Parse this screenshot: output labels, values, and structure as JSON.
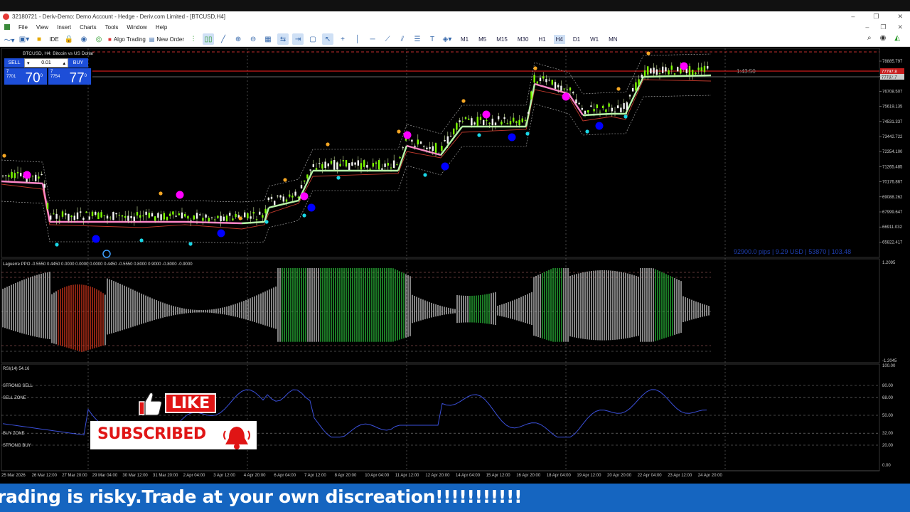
{
  "window": {
    "title": "32180721 - Deriv-Demo: Demo Account - Hedge - Deriv.com Limited - [BTCUSD,H4]",
    "controls": [
      "–",
      "❐",
      "✕"
    ]
  },
  "menu": {
    "items": [
      "File",
      "View",
      "Insert",
      "Charts",
      "Tools",
      "Window",
      "Help"
    ],
    "right": [
      "–",
      "❐",
      "✕"
    ]
  },
  "toolbar": {
    "ide_label": "IDE",
    "algo_label": "Algo Trading",
    "new_order_label": "New Order",
    "timeframes": [
      "M1",
      "M5",
      "M15",
      "M30",
      "H1",
      "H4",
      "D1",
      "W1",
      "MN"
    ],
    "selected_timeframe": "H4"
  },
  "main_chart": {
    "symbol_label": "BTCUSD, H4:  Bitcoin vs US Dollar",
    "price_ticks": [
      "78885.797",
      "77796.000",
      "76708.507",
      "75619.135",
      "74531.337",
      "73442.722",
      "72354.100",
      "71265.485",
      "70176.867",
      "69088.262",
      "67999.647",
      "66911.032",
      "65822.417"
    ],
    "current_price_tag": "77797.8",
    "current_price_tag2": "77797.7",
    "countdown": "1:43:50",
    "overlay_info": "92900.0 pips | 9.29 USD | 53870 | 103.48"
  },
  "trade_panel": {
    "sell_label": "SELL",
    "buy_label": "BUY",
    "lot_value": "0.01",
    "sell_prefix_top": "7",
    "sell_prefix_bottom": "7701",
    "sell_big": "70",
    "sell_sup": "0",
    "buy_prefix_top": "7",
    "buy_prefix_bottom": "7754",
    "buy_big": "77",
    "buy_sup": "0"
  },
  "ppo_panel": {
    "label": "Laguerre PPO -0.5550 0.4450 0.0000 0.0000 0.0000 0.4450 -0.5550 0.8000 0.9000 -0.8000 -0.9000",
    "top_tick": "1.2095",
    "bottom_tick": "-1.2045"
  },
  "rsi_panel": {
    "label": "RSI(14) 54.16",
    "zones": [
      "STRONG SELL",
      "SELL ZONE",
      "BUY ZONE",
      "STRONG BUY"
    ],
    "ticks": [
      "100.00",
      "80.00",
      "68.00",
      "50.00",
      "32.00",
      "20.00",
      "0.00"
    ]
  },
  "time_axis": [
    "25 Mar 2026",
    "26 Mar 12:00",
    "27 Mar 20:00",
    "29 Mar 04:00",
    "30 Mar 12:00",
    "31 Mar 20:00",
    "2 Apr 04:00",
    "3 Apr 12:00",
    "4 Apr 20:00",
    "6 Apr 04:00",
    "7 Apr 12:00",
    "8 Apr 20:00",
    "10 Apr 04:00",
    "11 Apr 12:00",
    "12 Apr 20:00",
    "14 Apr 04:00",
    "15 Apr 12:00",
    "16 Apr 20:00",
    "18 Apr 04:00",
    "19 Apr 12:00",
    "20 Apr 20:00",
    "22 Apr 04:00",
    "23 Apr 12:00",
    "24 Apr 20:00"
  ],
  "overlay": {
    "like_text": "LIKE",
    "subscribed_text": "SUBSCRIBED"
  },
  "ticker": {
    "message": "Trading is risky.Trade at your own discreation!!!!!!!!!!!"
  },
  "colors": {
    "accent_blue": "#1d4ed8",
    "candle_green": "#7CFC00",
    "signal_magenta": "#ff00ff",
    "ticker_blue": "#1565c0",
    "like_red": "#e01515"
  }
}
